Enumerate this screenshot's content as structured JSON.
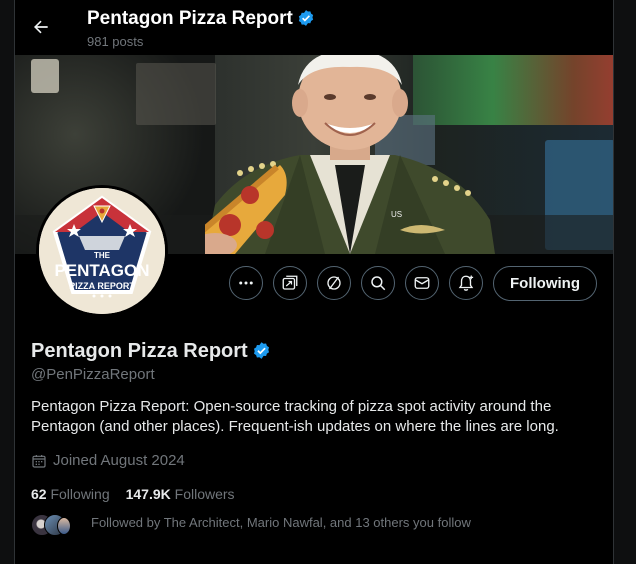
{
  "header": {
    "title": "Pentagon Pizza Report",
    "post_count": "981 posts"
  },
  "profile": {
    "display_name": "Pentagon Pizza Report",
    "handle": "@PenPizzaReport",
    "bio": "Pentagon Pizza Report: Open-source tracking of pizza spot activity around the Pentagon (and other places). Frequent-ish updates on where the lines are long.",
    "joined": "Joined August 2024",
    "following_count": "62",
    "following_label": "Following",
    "followers_count": "147.9K",
    "followers_label": "Followers",
    "followed_by": "Followed by The Architect, Mario Nawfal, and 13 others you follow",
    "avatar_logo": {
      "line1": "THE",
      "line2": "PENTAGON",
      "line3": "PIZZA REPORT"
    },
    "banner_patch": "US"
  },
  "actions": {
    "follow_button": "Following",
    "icons": [
      "more-icon",
      "grok-icon",
      "no-entry-icon",
      "search-icon",
      "message-icon",
      "notification-bell-icon"
    ]
  },
  "colors": {
    "verified": "#1d9bf0",
    "background": "#000000",
    "secondary_text": "#71767b",
    "border": "#536471"
  }
}
